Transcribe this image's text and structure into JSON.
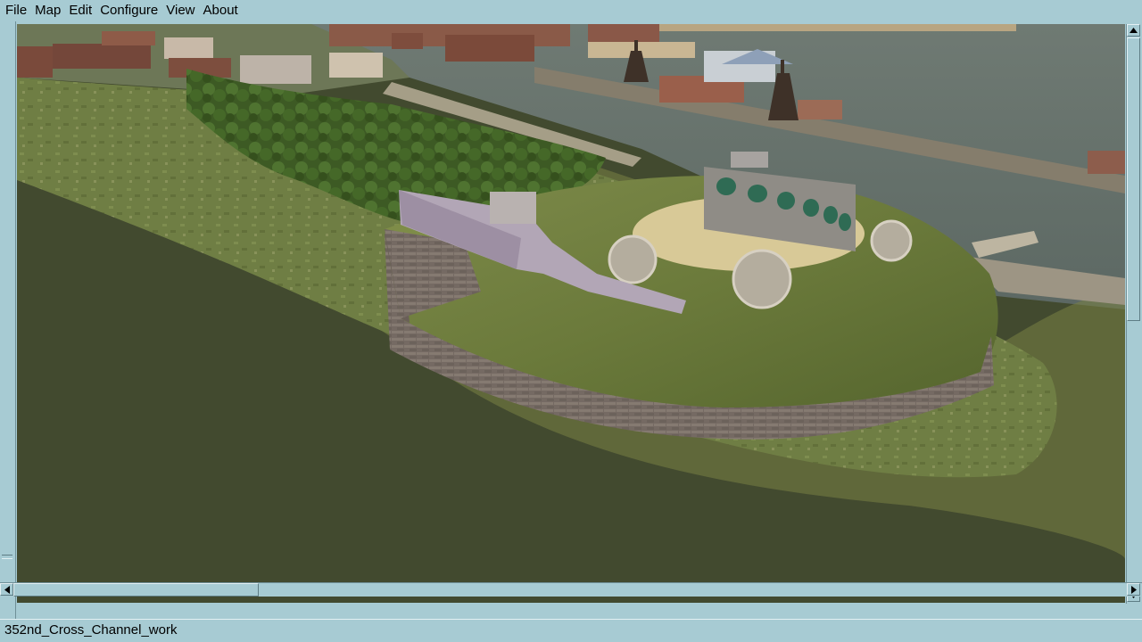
{
  "menu": {
    "items": [
      {
        "label": "File"
      },
      {
        "label": "Map"
      },
      {
        "label": "Edit"
      },
      {
        "label": "Configure"
      },
      {
        "label": "View"
      },
      {
        "label": "About"
      }
    ]
  },
  "viewport": {
    "scene": "3d-fort-island-view"
  },
  "status": {
    "text": "352nd_Cross_Channel_work"
  },
  "colors": {
    "chrome": "#a7cbd3",
    "shadow": "#5e7d85",
    "highlight": "#e3f0f3",
    "water": "#424a2f"
  },
  "icons": {
    "scroll_up": "arrow-up-icon",
    "scroll_down": "arrow-down-icon",
    "scroll_left": "arrow-left-icon",
    "scroll_right": "arrow-right-icon"
  }
}
